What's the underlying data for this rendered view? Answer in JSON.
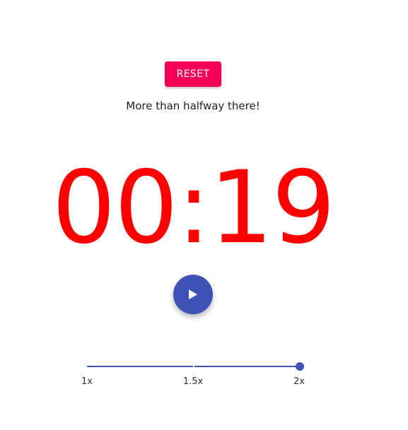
{
  "reset_button": {
    "label": "RESET"
  },
  "status": {
    "message": "More than halfway there!"
  },
  "timer": {
    "display": "00:19",
    "color": "#ff0000"
  },
  "play_button": {
    "icon": "play-icon",
    "color": "#3f51b5"
  },
  "speed_slider": {
    "marks": [
      "1x",
      "1.5x",
      "2x"
    ],
    "selected": "2x",
    "fill_fraction": 1.0,
    "color": "#3f51b5"
  },
  "colors": {
    "accent": "#f50057",
    "primary": "#3f51b5",
    "timer": "#ff0000"
  }
}
